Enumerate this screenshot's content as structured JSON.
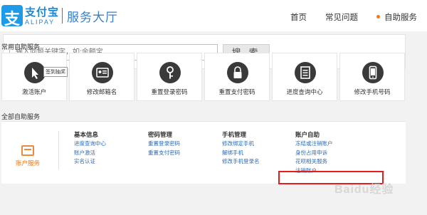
{
  "header": {
    "logo_mark": "支",
    "logo_cn": "支付宝",
    "logo_en": "ALIPAY",
    "service_title": "服务大厅",
    "nav": [
      {
        "label": "首页"
      },
      {
        "label": "常见问题"
      },
      {
        "label": "自助服务"
      }
    ],
    "accent_color": "#f07a1a"
  },
  "search": {
    "placeholder": "输入问题关键字，如:余额宝",
    "button_label": "搜 索"
  },
  "common_services": {
    "title": "常用自助服务",
    "tooltip": "签到抽奖",
    "items": [
      {
        "label": "激活账户",
        "icon": "cursor-icon"
      },
      {
        "label": "修改邮箱名",
        "icon": "id-card-icon"
      },
      {
        "label": "重置登录密码",
        "icon": "key-icon"
      },
      {
        "label": "重置支付密码",
        "icon": "lock-icon"
      },
      {
        "label": "进度查询中心",
        "icon": "document-icon"
      },
      {
        "label": "修改手机号码",
        "icon": "mobile-icon"
      }
    ]
  },
  "all_services": {
    "title": "全部自助服务",
    "account_service_label": "账户服务",
    "columns": [
      {
        "title": "基本信息",
        "links": [
          "进度查询中心",
          "账户激活",
          "实名认证"
        ]
      },
      {
        "title": "密码管理",
        "links": [
          "重置登录密码",
          "重置支付密码"
        ]
      },
      {
        "title": "手机管理",
        "links": [
          "修改绑定手机",
          "解绑手机",
          "修改手机登录名"
        ]
      },
      {
        "title": "账户自助",
        "links": [
          "冻结或注销账户",
          "身份占用申诉",
          "花呗相关服务",
          "注销账户"
        ]
      }
    ]
  },
  "watermark": "Baidu经验"
}
